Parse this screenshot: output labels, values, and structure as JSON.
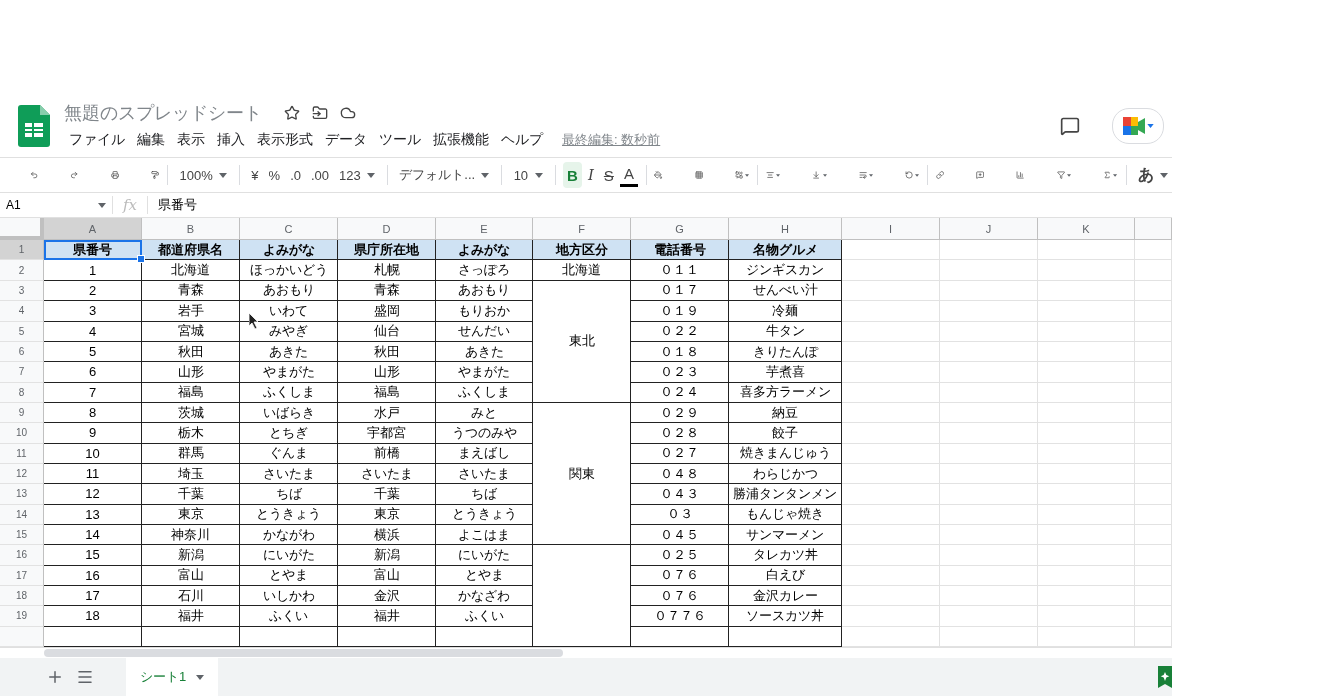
{
  "document": {
    "title": "無題のスプレッドシート",
    "last_edit": "最終編集: 数秒前"
  },
  "menu": [
    "ファイル",
    "編集",
    "表示",
    "挿入",
    "表示形式",
    "データ",
    "ツール",
    "拡張機能",
    "ヘルプ"
  ],
  "toolbar": {
    "zoom": "100%",
    "currency": "¥",
    "percent": "%",
    "decrease_decimals": ".0",
    "increase_decimals": ".00",
    "number_format": "123",
    "font": "デフォルト...",
    "font_size": "10",
    "bold": {
      "label": "B",
      "selected": true
    },
    "italic": {
      "label": "I",
      "selected": false
    },
    "strikethrough": {
      "label": "S",
      "selected": false
    },
    "text_color": "A",
    "input_tools": "あ"
  },
  "formula_bar": {
    "name_box": "A1",
    "fx": "fx",
    "value": "県番号"
  },
  "columns": [
    {
      "label": "A",
      "selected": true
    },
    {
      "label": "B",
      "selected": false
    },
    {
      "label": "C",
      "selected": false
    },
    {
      "label": "D",
      "selected": false
    },
    {
      "label": "E",
      "selected": false
    },
    {
      "label": "F",
      "selected": false
    },
    {
      "label": "G",
      "selected": false
    },
    {
      "label": "H",
      "selected": false
    },
    {
      "label": "I",
      "selected": false
    },
    {
      "label": "J",
      "selected": false
    },
    {
      "label": "K",
      "selected": false
    }
  ],
  "header_row": {
    "number": "1",
    "selected": true,
    "cells": [
      "県番号",
      "都道府県名",
      "よみがな",
      "県庁所在地",
      "よみがな",
      "地方区分",
      "電話番号",
      "名物グルメ"
    ]
  },
  "regions": [
    {
      "label": "北海道",
      "rows": [
        {
          "number": "2",
          "cells": [
            "1",
            "北海道",
            "ほっかいどう",
            "札幌",
            "さっぽろ",
            "０１１",
            "ジンギスカン"
          ]
        }
      ]
    },
    {
      "label": "東北",
      "rows": [
        {
          "number": "3",
          "cells": [
            "2",
            "青森",
            "あおもり",
            "青森",
            "あおもり",
            "０１７",
            "せんべい汁"
          ]
        },
        {
          "number": "4",
          "cells": [
            "3",
            "岩手",
            "いわて",
            "盛岡",
            "もりおか",
            "０１９",
            "冷麺"
          ]
        },
        {
          "number": "5",
          "cells": [
            "4",
            "宮城",
            "みやぎ",
            "仙台",
            "せんだい",
            "０２２",
            "牛タン"
          ]
        },
        {
          "number": "6",
          "cells": [
            "5",
            "秋田",
            "あきた",
            "秋田",
            "あきた",
            "０１８",
            "きりたんぽ"
          ]
        },
        {
          "number": "7",
          "cells": [
            "6",
            "山形",
            "やまがた",
            "山形",
            "やまがた",
            "０２３",
            "芋煮喜"
          ]
        },
        {
          "number": "8",
          "cells": [
            "7",
            "福島",
            "ふくしま",
            "福島",
            "ふくしま",
            "０２４",
            "喜多方ラーメン"
          ]
        }
      ]
    },
    {
      "label": "関東",
      "rows": [
        {
          "number": "9",
          "cells": [
            "8",
            "茨城",
            "いばらき",
            "水戸",
            "みと",
            "０２９",
            "納豆"
          ]
        },
        {
          "number": "10",
          "cells": [
            "9",
            "栃木",
            "とちぎ",
            "宇都宮",
            "うつのみや",
            "０２８",
            "餃子"
          ]
        },
        {
          "number": "11",
          "cells": [
            "10",
            "群馬",
            "ぐんま",
            "前橋",
            "まえばし",
            "０２７",
            "焼きまんじゅう"
          ]
        },
        {
          "number": "12",
          "cells": [
            "11",
            "埼玉",
            "さいたま",
            "さいたま",
            "さいたま",
            "０４８",
            "わらじかつ"
          ]
        },
        {
          "number": "13",
          "cells": [
            "12",
            "千葉",
            "ちば",
            "千葉",
            "ちば",
            "０４３",
            "勝浦タンタンメン"
          ]
        },
        {
          "number": "14",
          "cells": [
            "13",
            "東京",
            "とうきょう",
            "東京",
            "とうきょう",
            "０３",
            "もんじゃ焼き"
          ]
        },
        {
          "number": "15",
          "cells": [
            "14",
            "神奈川",
            "かながわ",
            "横浜",
            "よこはま",
            "０４５",
            "サンマーメン"
          ]
        }
      ]
    },
    {
      "rows": [
        {
          "number": "16",
          "cells": [
            "15",
            "新潟",
            "にいがた",
            "新潟",
            "にいがた",
            "０２５",
            "タレカツ丼"
          ]
        },
        {
          "number": "17",
          "cells": [
            "16",
            "富山",
            "とやま",
            "富山",
            "とやま",
            "０７６",
            "白えび"
          ]
        },
        {
          "number": "18",
          "cells": [
            "17",
            "石川",
            "いしかわ",
            "金沢",
            "かなざわ",
            "０７６",
            "金沢カレー"
          ]
        },
        {
          "number": "19",
          "cells": [
            "18",
            "福井",
            "ふくい",
            "福井",
            "ふくい",
            "０７７６",
            "ソースカツ丼"
          ]
        }
      ]
    }
  ],
  "sheet_tabs": [
    {
      "label": "シート1",
      "selected": true
    }
  ]
}
